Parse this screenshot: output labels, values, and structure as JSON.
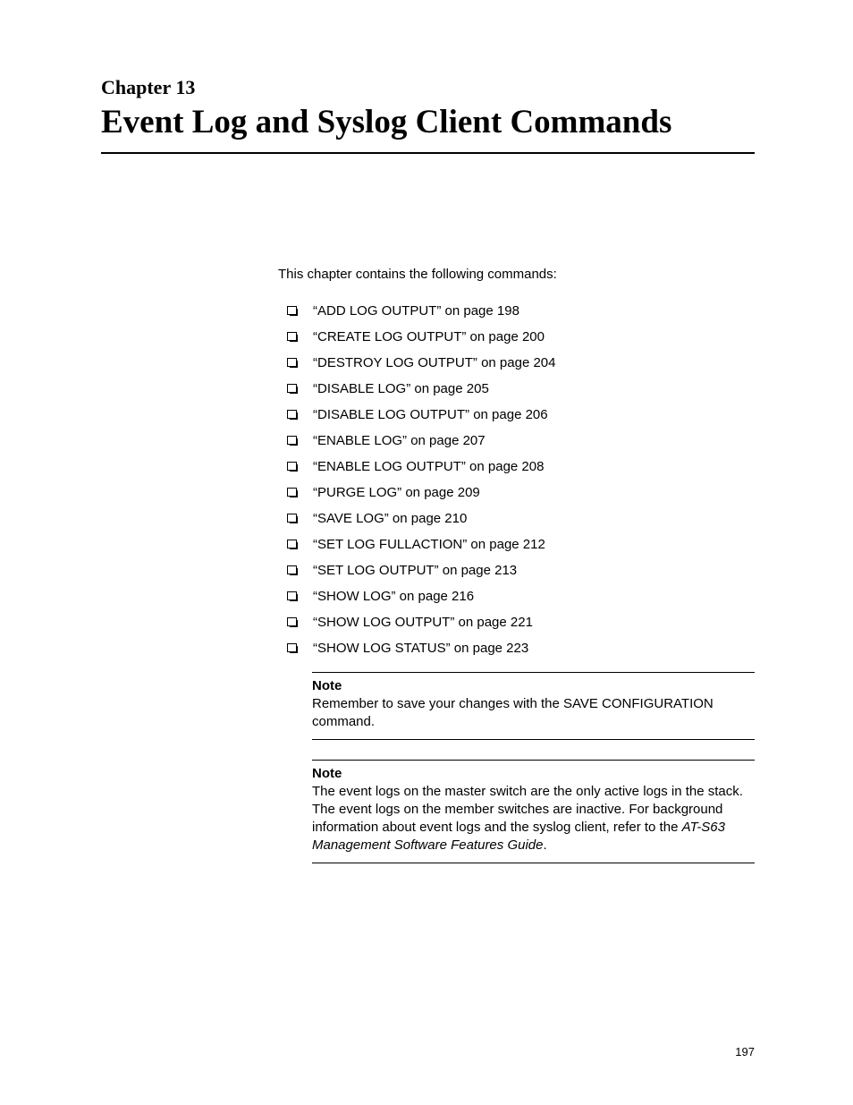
{
  "chapter": {
    "label": "Chapter 13",
    "title": "Event Log and Syslog Client Commands"
  },
  "intro": "This chapter contains the following commands:",
  "toc": [
    "“ADD LOG OUTPUT” on page 198",
    "“CREATE LOG OUTPUT” on page 200",
    "“DESTROY LOG OUTPUT” on page 204",
    "“DISABLE LOG” on page 205",
    "“DISABLE LOG OUTPUT” on page 206",
    "“ENABLE LOG” on page 207",
    "“ENABLE LOG OUTPUT” on page 208",
    "“PURGE LOG” on page 209",
    "“SAVE LOG” on page 210",
    "“SET LOG FULLACTION” on page 212",
    "“SET LOG OUTPUT” on page 213",
    "“SHOW LOG” on page 216",
    "“SHOW LOG OUTPUT” on page 221",
    "“SHOW LOG STATUS” on page 223"
  ],
  "notes": [
    {
      "label": "Note",
      "text": "Remember to save your changes with the SAVE CONFIGURATION command."
    },
    {
      "label": "Note",
      "text_pre": "The event logs on the master switch are the only active logs in the stack. The event logs on the member switches are inactive. For background information about event logs and the syslog client, refer to the ",
      "text_italic": "AT-S63 Management Software Features Guide",
      "text_post": "."
    }
  ],
  "page_number": "197",
  "chart_data": null
}
